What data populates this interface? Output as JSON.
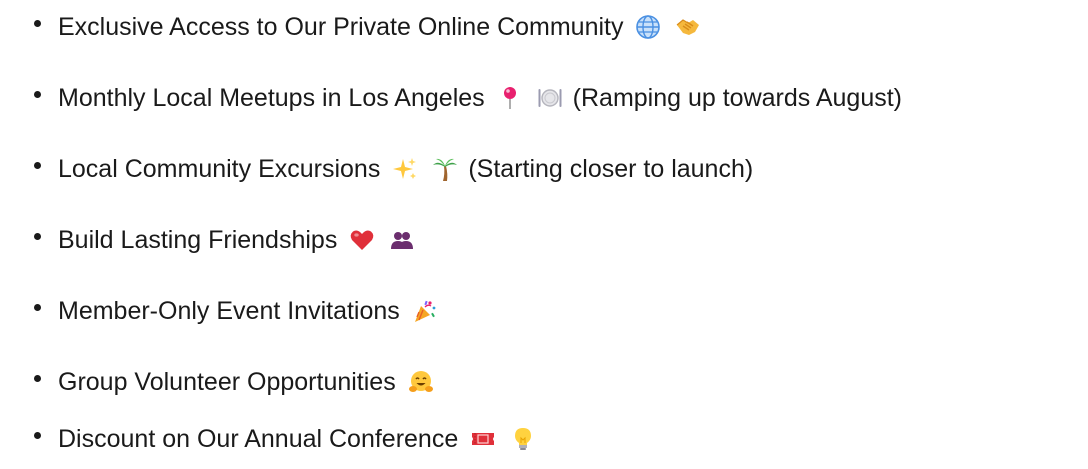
{
  "benefits": [
    {
      "label": "Exclusive Access to Our Private Online Community",
      "icons": [
        "globe-icon",
        "handshake-icon"
      ],
      "note": ""
    },
    {
      "label": "Monthly Local Meetups in Los Angeles",
      "icons": [
        "round-pushpin-icon",
        "plate-icon"
      ],
      "note": "(Ramping up towards August)"
    },
    {
      "label": "Local Community Excursions",
      "icons": [
        "sparkles-icon",
        "palm-tree-icon"
      ],
      "note": "(Starting closer to launch)"
    },
    {
      "label": "Build Lasting Friendships",
      "icons": [
        "red-heart-icon",
        "two-people-icon"
      ],
      "note": ""
    },
    {
      "label": "Member-Only Event Invitations",
      "icons": [
        "party-popper-icon"
      ],
      "note": ""
    },
    {
      "label": "Group Volunteer Opportunities",
      "icons": [
        "hugging-face-icon"
      ],
      "note": ""
    },
    {
      "label": "Discount on Our Annual Conference",
      "icons": [
        "ticket-icon",
        "light-bulb-icon"
      ],
      "note": ""
    }
  ]
}
